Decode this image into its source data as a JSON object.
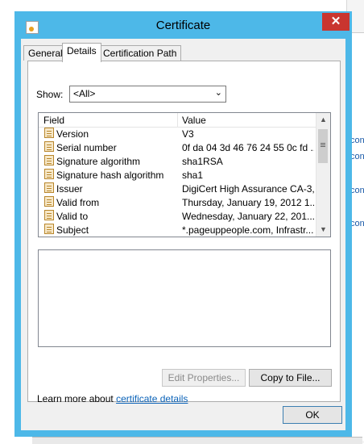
{
  "window": {
    "title": "Certificate",
    "close_symbol": "✕"
  },
  "tabs": [
    {
      "label": "General",
      "active": false
    },
    {
      "label": "Details",
      "active": true
    },
    {
      "label": "Certification Path",
      "active": false
    }
  ],
  "show": {
    "label": "Show:",
    "value": "<All>"
  },
  "fields": {
    "headers": {
      "field": "Field",
      "value": "Value"
    },
    "rows": [
      {
        "field": "Version",
        "value": "V3"
      },
      {
        "field": "Serial number",
        "value": "0f da 04 3d 46 76 24 55 0c fd ..."
      },
      {
        "field": "Signature algorithm",
        "value": "sha1RSA"
      },
      {
        "field": "Signature hash algorithm",
        "value": "sha1"
      },
      {
        "field": "Issuer",
        "value": "DigiCert High Assurance CA-3,..."
      },
      {
        "field": "Valid from",
        "value": "Thursday, January 19, 2012 1..."
      },
      {
        "field": "Valid to",
        "value": "Wednesday, January 22, 201..."
      },
      {
        "field": "Subject",
        "value": "*.pageuppeople.com, Infrastr..."
      }
    ]
  },
  "buttons": {
    "edit_properties": "Edit Properties...",
    "copy_to_file": "Copy to File...",
    "ok": "OK"
  },
  "learn_more": {
    "prefix": "Learn more about ",
    "link": "certificate details"
  },
  "background": {
    "fragments": [
      "con",
      "con",
      "con",
      "con"
    ]
  },
  "colors": {
    "frame": "#4db8e8",
    "close": "#c9352f",
    "link": "#0a62b8"
  }
}
